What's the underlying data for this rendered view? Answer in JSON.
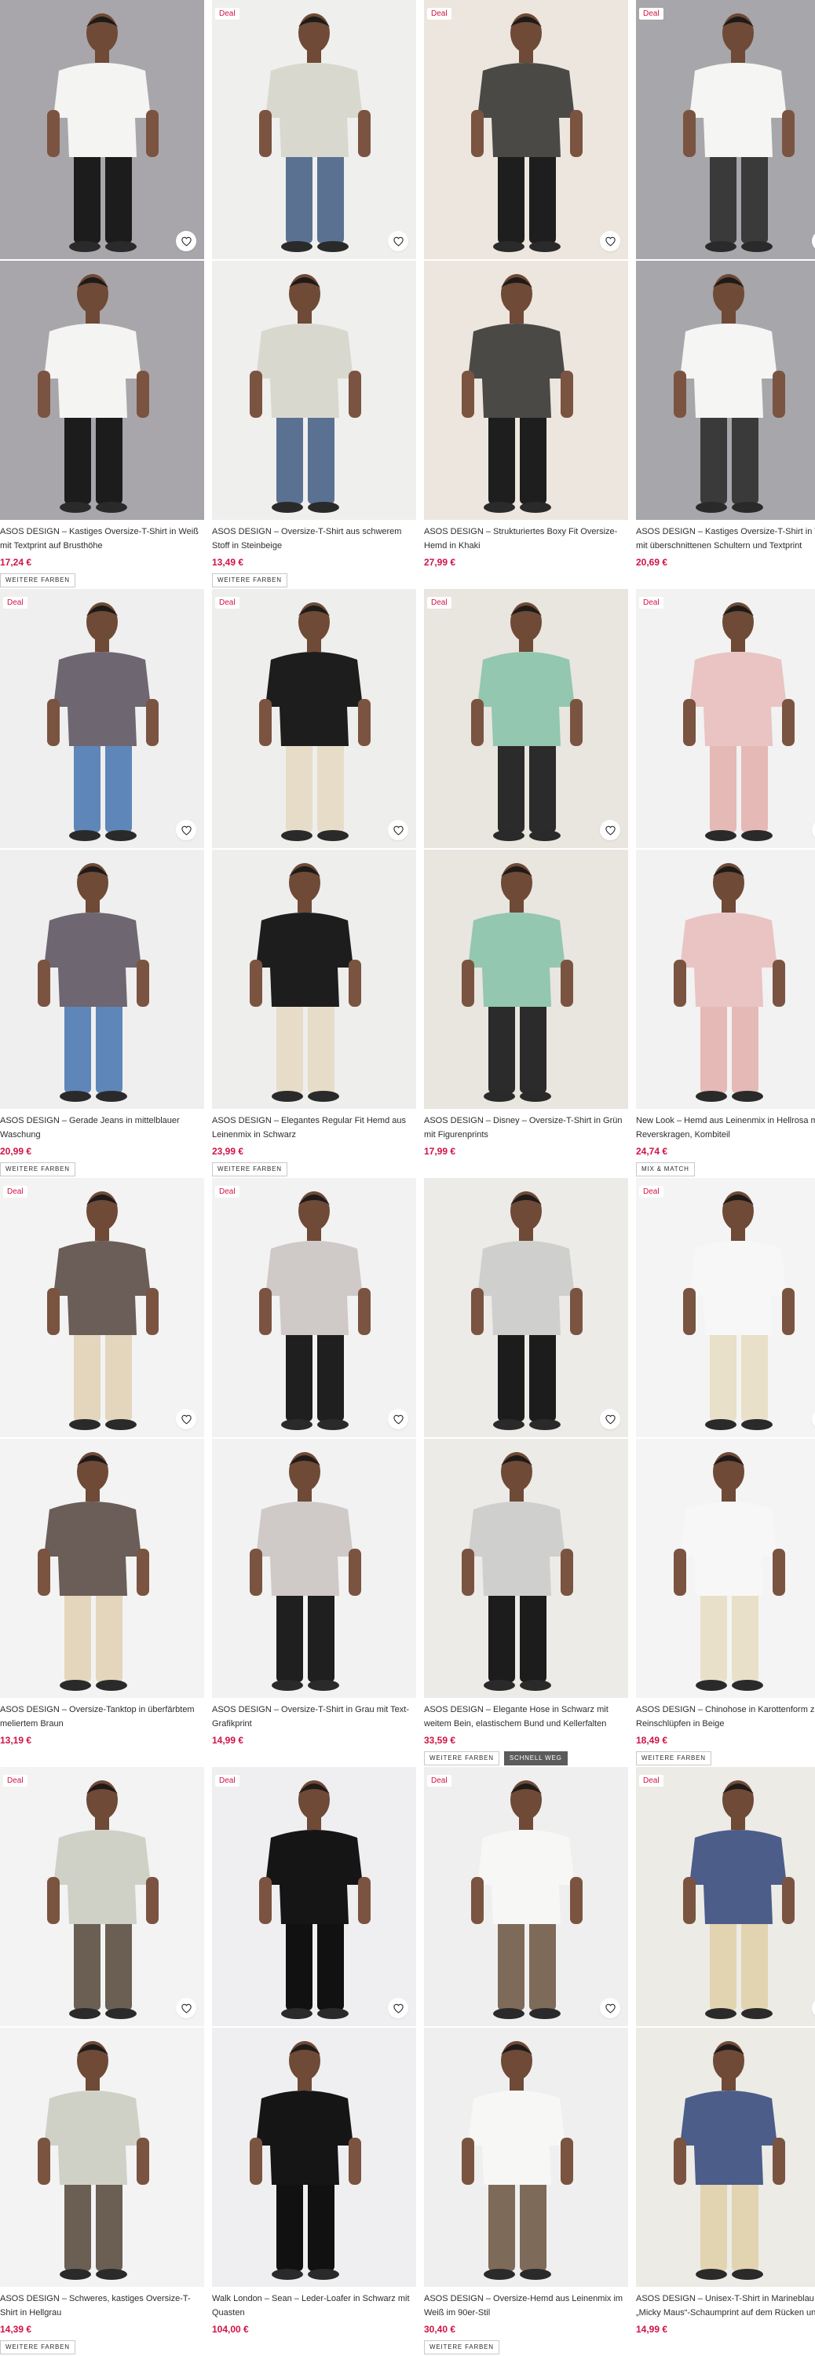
{
  "heart_label": "♡",
  "products": [
    {
      "title": "ASOS DESIGN – Kastiges Oversize-T-Shirt in Weiß mit Textprint auf Brusthöhe",
      "price": "17,24 €",
      "deal": false,
      "deal_label": "",
      "tags": [
        "WEITERE FARBEN"
      ],
      "bg": "#a9a6ab",
      "shirt": "#f4f4f2",
      "pants": "#1c1c1c"
    },
    {
      "title": "ASOS DESIGN – Oversize-T-Shirt aus schwerem Stoff in Steinbeige",
      "price": "13,49 €",
      "deal": true,
      "deal_label": "Deal",
      "tags": [
        "WEITERE FARBEN"
      ],
      "bg": "#efefed",
      "shirt": "#d9d8cf",
      "pants": "#5a7192"
    },
    {
      "title": "ASOS DESIGN – Strukturiertes Boxy Fit Oversize-Hemd in Khaki",
      "price": "27,99 €",
      "deal": true,
      "deal_label": "Deal",
      "tags": [],
      "bg": "#ece6de",
      "shirt": "#4a4946",
      "pants": "#1e1e1e"
    },
    {
      "title": "ASOS DESIGN – Kastiges Oversize-T-Shirt in Weiß mit überschnittenen Schultern und Textprint",
      "price": "20,69 €",
      "deal": true,
      "deal_label": "Deal",
      "tags": [],
      "bg": "#a7a6aa",
      "shirt": "#f5f5f3",
      "pants": "#3a3a3a"
    },
    {
      "title": "ASOS DESIGN – Gerade Jeans in mittelblauer Waschung",
      "price": "20,99 €",
      "deal": true,
      "deal_label": "Deal",
      "tags": [
        "WEITERE FARBEN"
      ],
      "bg": "#efefef",
      "shirt": "#6e6670",
      "pants": "#5f86b8"
    },
    {
      "title": "ASOS DESIGN – Elegantes Regular Fit Hemd aus Leinenmix in Schwarz",
      "price": "23,99 €",
      "deal": true,
      "deal_label": "Deal",
      "tags": [
        "WEITERE FARBEN"
      ],
      "bg": "#eeeeec",
      "shirt": "#1d1d1d",
      "pants": "#e6dcc8"
    },
    {
      "title": "ASOS DESIGN – Disney – Oversize-T-Shirt in Grün mit Figurenprints",
      "price": "17,99 €",
      "deal": true,
      "deal_label": "Deal",
      "tags": [],
      "bg": "#e9e5df",
      "shirt": "#93c7af",
      "pants": "#2b2b2b"
    },
    {
      "title": "New Look – Hemd aus Leinenmix in Hellrosa mit Reverskragen, Kombiteil",
      "price": "24,74 €",
      "deal": true,
      "deal_label": "Deal",
      "tags": [
        "MIX & MATCH"
      ],
      "bg": "#f2f2f2",
      "shirt": "#e9c4c2",
      "pants": "#e5b9b6"
    },
    {
      "title": "ASOS DESIGN – Oversize-Tanktop in überfärbtem meliertem Braun",
      "price": "13,19 €",
      "deal": true,
      "deal_label": "Deal",
      "tags": [],
      "bg": "#f3f3f3",
      "shirt": "#6b5d57",
      "pants": "#e3d6bc"
    },
    {
      "title": "ASOS DESIGN – Oversize-T-Shirt in Grau mit Text-Grafikprint",
      "price": "14,99 €",
      "deal": true,
      "deal_label": "Deal",
      "tags": [],
      "bg": "#f2f2f2",
      "shirt": "#cfc9c8",
      "pants": "#1f1f1f"
    },
    {
      "title": "ASOS DESIGN – Elegante Hose in Schwarz mit weitem Bein, elastischem Bund und Kellerfalten",
      "price": "33,59 €",
      "deal": false,
      "deal_label": "",
      "tags": [
        "WEITERE FARBEN",
        "SCHNELL WEG"
      ],
      "bg": "#ecebe8",
      "shirt": "#cfcfcd",
      "pants": "#1c1c1c"
    },
    {
      "title": "ASOS DESIGN – Chinohose in Karottenform zum Reinschlüpfen in Beige",
      "price": "18,49 €",
      "deal": true,
      "deal_label": "Deal",
      "tags": [
        "WEITERE FARBEN"
      ],
      "bg": "#f4f4f4",
      "shirt": "#f7f7f7",
      "pants": "#e8e0c8"
    },
    {
      "title": "ASOS DESIGN – Schweres, kastiges Oversize-T-Shirt in Hellgrau",
      "price": "14,39 €",
      "deal": true,
      "deal_label": "Deal",
      "tags": [
        "WEITERE FARBEN"
      ],
      "bg": "#f3f3f3",
      "shirt": "#cfd1c7",
      "pants": "#6a5f52"
    },
    {
      "title": "Walk London – Sean – Leder-Loafer in Schwarz mit Quasten",
      "price": "104,00 €",
      "deal": true,
      "deal_label": "Deal",
      "tags": [],
      "bg": "#efeff1",
      "shirt": "#151515",
      "pants": "#111111"
    },
    {
      "title": "ASOS DESIGN – Oversize-Hemd aus Leinenmix im Weiß im 90er-Stil",
      "price": "30,40 €",
      "deal": true,
      "deal_label": "Deal",
      "tags": [
        "WEITERE FARBEN"
      ],
      "bg": "#efefef",
      "shirt": "#f7f7f5",
      "pants": "#7d6a58"
    },
    {
      "title": "ASOS DESIGN – Unisex-T-Shirt in Marineblau „Micky Maus“-Schaumprint auf dem Rücken und",
      "price": "14,99 €",
      "deal": true,
      "deal_label": "Deal",
      "tags": [],
      "bg": "#ecebe6",
      "shirt": "#4c5d8a",
      "pants": "#e2d4b0"
    }
  ]
}
